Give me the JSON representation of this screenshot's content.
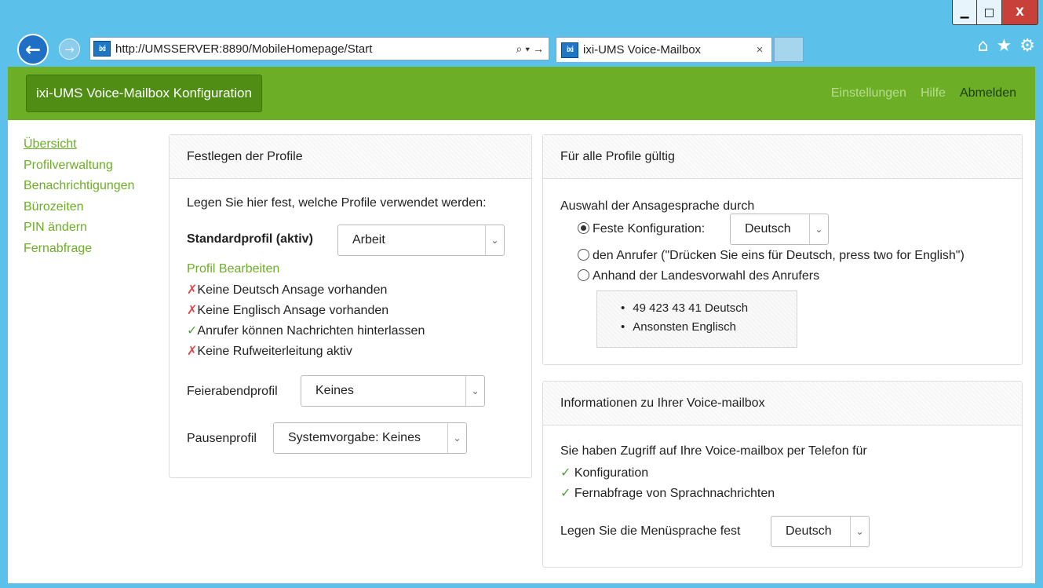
{
  "browser": {
    "url": "http://UMSSERVER:8890/MobileHomepage/Start",
    "address_icons": "⌕ ▾ →",
    "tab_title": "ixi-UMS Voice-Mailbox",
    "tab_close": "×",
    "favicon_text": "ixi",
    "window_buttons": {
      "minimize": "▁",
      "maximize": "□",
      "close": "X"
    },
    "toolbar_icons": {
      "home": "⌂",
      "favorites": "★",
      "settings": "⚙"
    }
  },
  "navbar": {
    "brand": "ixi-UMS Voice-Mailbox Konfiguration",
    "links": [
      {
        "label": "Einstellungen",
        "style": "muted"
      },
      {
        "label": "Hilfe",
        "style": "muted"
      },
      {
        "label": "Abmelden",
        "style": "strong"
      }
    ]
  },
  "sidebar": {
    "items": [
      "Übersicht",
      "Profilverwaltung",
      "Benachrichtigungen",
      "Bürozeiten",
      "PIN ändern",
      "Fernabfrage"
    ]
  },
  "profiles_panel": {
    "title": "Festlegen der Profile",
    "intro": "Legen Sie hier fest, welche Profile verwendet werden:",
    "standard_label": "Standardprofil (aktiv)",
    "standard_value": "Arbeit",
    "edit_link": "Profil Bearbeiten",
    "status": [
      {
        "mark": "✗",
        "kind": "x",
        "text": "Keine Deutsch Ansage vorhanden"
      },
      {
        "mark": "✗",
        "kind": "x",
        "text": "Keine Englisch Ansage vorhanden"
      },
      {
        "mark": "✓",
        "kind": "ok",
        "text": "Anrufer können Nachrichten hinterlassen"
      },
      {
        "mark": "✗",
        "kind": "x",
        "text": "Keine Rufweiterleitung aktiv"
      }
    ],
    "feierabend_label": "Feierabendprofil",
    "feierabend_value": "Keines",
    "pause_label": "Pausenprofil",
    "pause_value": "Systemvorgabe: Keines"
  },
  "global_panel": {
    "title": "Für alle Profile gültig",
    "intro": "Auswahl der Ansagesprache durch",
    "option_fixed": "Feste Konfiguration:",
    "fixed_value": "Deutsch",
    "option_caller": "den Anrufer (\"Drücken Sie eins für Deutsch, press two for English\")",
    "option_country": "Anhand der Landesvorwahl des Anrufers",
    "country_list": [
      "49  423  43  41  Deutsch",
      "Ansonsten Englisch"
    ]
  },
  "info_panel": {
    "title": "Informationen zu Ihrer Voice-mailbox",
    "intro": "Sie haben Zugriff auf Ihre Voice-mailbox per Telefon für",
    "items": [
      {
        "mark": "✓",
        "text": "Konfiguration"
      },
      {
        "mark": "✓",
        "text": "Fernabfrage von Sprachnachrichten"
      }
    ],
    "menu_lang_label": "Legen Sie die Menüsprache fest",
    "menu_lang_value": "Deutsch"
  },
  "colors": {
    "accent_green": "#6cae25",
    "brand_dark": "#4f8d14",
    "error_red": "#e0484b",
    "ok_green": "#4ca33d"
  }
}
